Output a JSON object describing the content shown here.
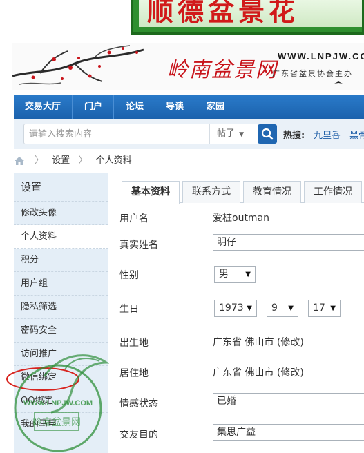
{
  "banner": {
    "text": "顺德盆景花"
  },
  "header": {
    "logo_text": "岭南盆景网",
    "logo_url": "WWW.LNPJW.COM",
    "logo_sub": "广东省盆景协会主办"
  },
  "nav": {
    "items": [
      "交易大厅",
      "门户",
      "论坛",
      "导读",
      "家园"
    ]
  },
  "search": {
    "placeholder": "请输入搜索内容",
    "type_label": "帖子",
    "hot_label": "热搜:",
    "hot_links": [
      "九里香",
      "黑骨"
    ]
  },
  "breadcrumb": {
    "items": [
      "设置",
      "个人资料"
    ]
  },
  "sidebar": {
    "title": "设置",
    "items": [
      {
        "label": "修改头像"
      },
      {
        "label": "个人资料"
      },
      {
        "label": "积分"
      },
      {
        "label": "用户组"
      },
      {
        "label": "隐私筛选"
      },
      {
        "label": "密码安全"
      },
      {
        "label": "访问推广"
      },
      {
        "label": "微信绑定"
      },
      {
        "label": "QQ绑定"
      },
      {
        "label": "我的马甲"
      }
    ],
    "active_index": 1
  },
  "watermark": {
    "text": "WWW.LNPJW.COM",
    "seal": "岭南盆景网"
  },
  "tabs": [
    {
      "label": "基本资料"
    },
    {
      "label": "联系方式"
    },
    {
      "label": "教育情况"
    },
    {
      "label": "工作情况"
    }
  ],
  "profile": {
    "username_label": "用户名",
    "username": "爱桩outman",
    "realname_label": "真实姓名",
    "realname": "明仔",
    "gender_label": "性别",
    "gender": "男",
    "birthday_label": "生日",
    "birth_year": "1973",
    "birth_month": "9",
    "birth_day": "17",
    "birthplace_label": "出生地",
    "birthplace": "广东省 佛山市",
    "residence_label": "居住地",
    "residence": "广东省 佛山市",
    "edit_label": "(修改)",
    "marital_label": "情感状态",
    "marital": "已婚",
    "purpose_label": "交友目的",
    "purpose": "集思广益"
  }
}
